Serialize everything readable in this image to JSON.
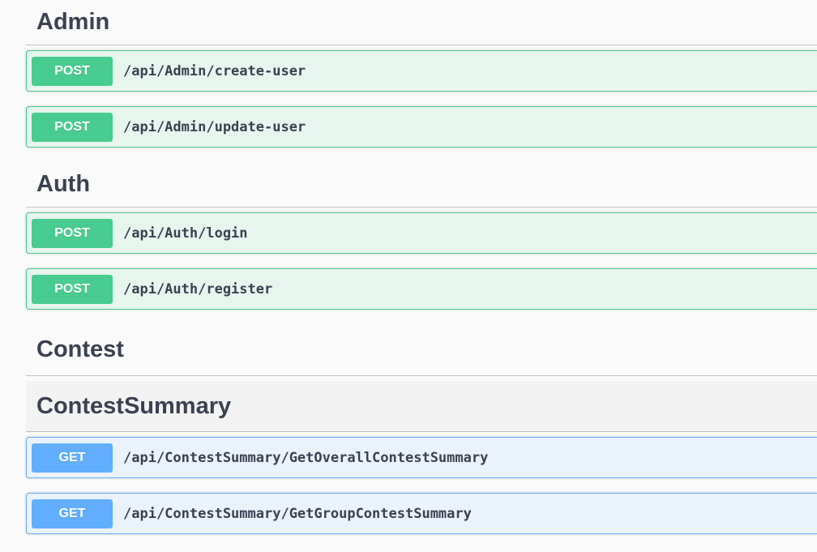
{
  "sections": [
    {
      "name": "Admin",
      "operations": [
        {
          "method": "POST",
          "path": "/api/Admin/create-user"
        },
        {
          "method": "POST",
          "path": "/api/Admin/update-user"
        }
      ]
    },
    {
      "name": "Auth",
      "operations": [
        {
          "method": "POST",
          "path": "/api/Auth/login"
        },
        {
          "method": "POST",
          "path": "/api/Auth/register"
        }
      ]
    },
    {
      "name": "Contest",
      "operations": []
    },
    {
      "name": "ContestSummary",
      "operations": [
        {
          "method": "GET",
          "path": "/api/ContestSummary/GetOverallContestSummary"
        },
        {
          "method": "GET",
          "path": "/api/ContestSummary/GetGroupContestSummary"
        }
      ]
    }
  ],
  "colors": {
    "post": "#49cc90",
    "get": "#61affe",
    "text": "#3b4151"
  }
}
